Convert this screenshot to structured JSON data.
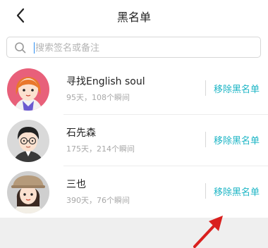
{
  "header": {
    "title": "黑名单",
    "back_icon": "chevron-left-icon"
  },
  "search": {
    "placeholder": "搜索签名或备注",
    "icon": "search-icon"
  },
  "blacklist": [
    {
      "name": "寻找English soul",
      "stats": "95天，108个瞬间",
      "action": "移除黑名单",
      "avatar": "avatar-red-hair-girl"
    },
    {
      "name": "石先森",
      "stats": "175天，214个瞬间",
      "action": "移除黑名单",
      "avatar": "avatar-glasses-boy"
    },
    {
      "name": "三也",
      "stats": "390天，76个瞬间",
      "action": "移除黑名单",
      "avatar": "avatar-hat-girl"
    }
  ],
  "colors": {
    "accent": "#1cb5c5",
    "annotation_arrow": "#d9201e"
  }
}
